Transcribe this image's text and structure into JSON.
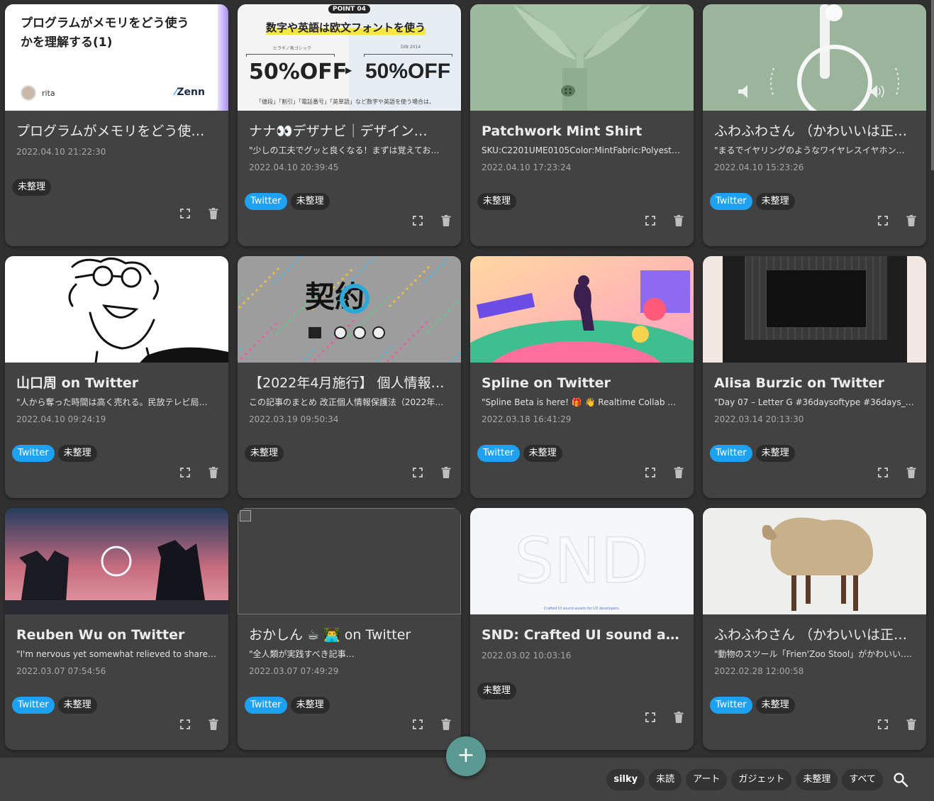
{
  "cards": [
    {
      "title": "プログラムがメモリをどう使…",
      "sub": "",
      "date": "2022.04.10 21:22:30",
      "tags": [
        "未整理"
      ],
      "light": true,
      "thumb": {
        "kind": "zenn",
        "headline_line1": "プログラムがメモリをどう使う",
        "headline_line2": "かを理解する(1)",
        "author": "rita",
        "brand": "Zenn"
      }
    },
    {
      "title": "ナナ👀デザナビ｜デザイン…",
      "sub": "\"少しの工夫でグッと良くなる！まずは覚えてお…",
      "date": "2022.04.10 20:39:45",
      "tags": [
        "Twitter",
        "未整理"
      ],
      "light": true,
      "thumb": {
        "kind": "font",
        "badge": "POINT 04",
        "headline": "数字や英語は欧文フォントを使う",
        "left_label": "ヒラギノ角ゴシック",
        "right_label": "DIN 2014",
        "left_big": "50%OFF",
        "right_big": "50%OFF",
        "caption": "「値段」「割引」「電話番号」「英単語」など数字や英語を使う場合は、"
      }
    },
    {
      "title": "Patchwork Mint Shirt",
      "sub": "SKU:C2201UME0105Color:MintFabric:Polyester…",
      "date": "2022.04.10 17:23:24",
      "tags": [
        "未整理"
      ],
      "light": false,
      "thumb": {
        "kind": "shirt"
      }
    },
    {
      "title": "ふわふわさん （かわいいは正…",
      "sub": "\"まるでイヤリングのようなワイヤレスイヤホン…",
      "date": "2022.04.10 15:23:26",
      "tags": [
        "Twitter",
        "未整理"
      ],
      "light": true,
      "thumb": {
        "kind": "earring"
      }
    },
    {
      "title": "山口周 on Twitter",
      "sub": "\"人から奪った時間は高く売れる。民放テレビ局…",
      "date": "2022.04.10 09:24:19",
      "tags": [
        "Twitter",
        "未整理"
      ],
      "light": false,
      "thumb": {
        "kind": "face"
      }
    },
    {
      "title": "【2022年4月施行】 個人情報…",
      "sub": "この記事のまとめ 改正個人情報保護法（2022年…",
      "date": "2022.03.19 09:50:34",
      "tags": [
        "未整理"
      ],
      "light": true,
      "thumb": {
        "kind": "contract"
      }
    },
    {
      "title": "Spline on Twitter",
      "sub": "\"Spline Beta is here! 🎁 👋 Realtime Collab +…",
      "date": "2022.03.18 16:41:29",
      "tags": [
        "Twitter",
        "未整理"
      ],
      "light": false,
      "thumb": {
        "kind": "spline"
      }
    },
    {
      "title": "Alisa Burzic on Twitter",
      "sub": "\"Day 07 – Letter G #36daysoftype #36days_G…",
      "date": "2022.03.14 20:13:30",
      "tags": [
        "Twitter",
        "未整理"
      ],
      "light": false,
      "thumb": {
        "kind": "letterg"
      }
    },
    {
      "title": "Reuben Wu on Twitter",
      "sub": "\"I'm nervous yet somewhat relieved to share my…",
      "date": "2022.03.07 07:54:56",
      "tags": [
        "Twitter",
        "未整理"
      ],
      "light": false,
      "thumb": {
        "kind": "ring"
      }
    },
    {
      "title": "おかしん ☕ 👨‍💻 on Twitter",
      "sub": "\"全人類が実践すべき記事…",
      "date": "2022.03.07 07:49:29",
      "tags": [
        "Twitter",
        "未整理"
      ],
      "light": true,
      "thumb": {
        "kind": "broken"
      }
    },
    {
      "title": "SND: Crafted UI sound assets…",
      "sub": "",
      "date": "2022.03.02 10:03:16",
      "tags": [
        "未整理"
      ],
      "light": false,
      "thumb": {
        "kind": "snd",
        "caption": "Crafted UI sound assets for UX developers."
      }
    },
    {
      "title": "ふわふわさん （かわいいは正…",
      "sub": "\"動物のスツール「Frien'Zoo Stool」がかわいい.…",
      "date": "2022.02.28 12:00:58",
      "tags": [
        "Twitter",
        "未整理"
      ],
      "light": true,
      "thumb": {
        "kind": "sheep"
      }
    }
  ],
  "fab_label": "+",
  "filters": [
    "silky",
    "未読",
    "アート",
    "ガジェット",
    "未整理",
    "すべて"
  ],
  "selected_filter": "silky",
  "colors": {
    "twitter": "#1da1f2",
    "fab": "#5b9a93",
    "card": "#424242",
    "background": "#303030"
  }
}
